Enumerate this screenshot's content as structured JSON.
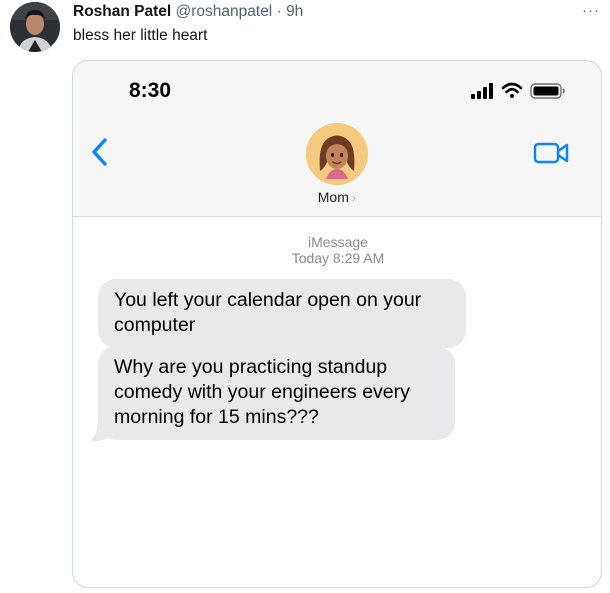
{
  "tweet": {
    "display_name": "Roshan Patel",
    "handle": "@roshanpatel",
    "separator": "·",
    "time": "9h",
    "text": "bless her little heart",
    "more_label": "···"
  },
  "phone": {
    "status_bar": {
      "time": "8:30"
    },
    "contact": {
      "name": "Mom",
      "chevron": "›"
    },
    "conversation": {
      "service": "iMessage",
      "timestamp": "Today 8:29 AM",
      "messages": [
        {
          "text": "You left your calendar open on your computer",
          "direction": "incoming"
        },
        {
          "text": "Why are you practicing standup comedy with your engineers every morning for 15 mins???",
          "direction": "incoming"
        }
      ]
    },
    "icons": {
      "back": "chevron-left-icon",
      "video": "video-camera-icon",
      "signal": "signal-bars-icon",
      "wifi": "wifi-icon",
      "battery": "battery-icon"
    }
  },
  "colors": {
    "ios_blue": "#0a84ff",
    "bubble_gray": "#e9e9eb",
    "header_bg": "#f6f6f6",
    "secondary_text": "#536471",
    "contact_avatar_bg": "#f5c97e"
  }
}
